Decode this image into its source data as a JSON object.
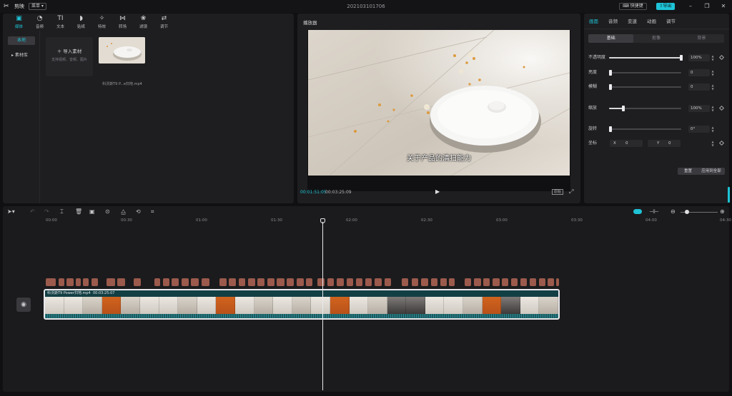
{
  "titlebar": {
    "app_name": "剪映",
    "menu_label": "菜单",
    "doc_title": "202103101706",
    "shortcut_label": "快捷键",
    "export_label": "导出"
  },
  "media": {
    "tabs": [
      {
        "label": "媒体",
        "icon": "media-icon",
        "glyph": "▣",
        "active": true
      },
      {
        "label": "音频",
        "icon": "audio-icon",
        "glyph": "◔",
        "active": false
      },
      {
        "label": "文本",
        "icon": "text-icon",
        "glyph": "TI",
        "active": false
      },
      {
        "label": "贴纸",
        "icon": "sticker-icon",
        "glyph": "◗",
        "active": false
      },
      {
        "label": "特效",
        "icon": "effect-icon",
        "glyph": "✧",
        "active": false
      },
      {
        "label": "转场",
        "icon": "transition-icon",
        "glyph": "⋈",
        "active": false
      },
      {
        "label": "滤镜",
        "icon": "filter-icon",
        "glyph": "❀",
        "active": false
      },
      {
        "label": "调节",
        "icon": "adjust-icon",
        "glyph": "⇄",
        "active": false
      }
    ],
    "side_local": "本地",
    "side_library": "素材库",
    "import_label": "导入素材",
    "import_hint": "支持视频、音频、图片",
    "thumb_name": "科沃斯T9 P...e扫地.mp4"
  },
  "player": {
    "title": "播放器",
    "subtitle": "关于产品的清扫能力",
    "time_current": "00:01:51:05",
    "time_total": "00:03:25:09",
    "ratio_label": "原始"
  },
  "props": {
    "tabs": [
      {
        "label": "画面",
        "active": true
      },
      {
        "label": "音频",
        "active": false
      },
      {
        "label": "变速",
        "active": false
      },
      {
        "label": "动画",
        "active": false
      },
      {
        "label": "调节",
        "active": false
      }
    ],
    "sub_tabs": [
      {
        "label": "基础",
        "active": true
      },
      {
        "label": "抠像",
        "active": false
      },
      {
        "label": "背景",
        "active": false
      }
    ],
    "opacity": {
      "label": "不透明度",
      "value": "100%",
      "level": 1.0
    },
    "brightness": {
      "label": "亮度",
      "value": "0",
      "level": 0.0
    },
    "blur": {
      "label": "模糊",
      "value": "0",
      "level": 0.0
    },
    "scale": {
      "label": "缩放",
      "value": "100%",
      "level": 0.2
    },
    "rotate": {
      "label": "旋转",
      "value": "0°",
      "level": 0.0
    },
    "position": {
      "label": "坐标",
      "x_label": "X",
      "x_value": "0",
      "y_label": "Y",
      "y_value": "0"
    },
    "reset_label": "重置",
    "apply_all_label": "应用到全部"
  },
  "timeline": {
    "ruler": [
      "00:00",
      "00:30",
      "01:00",
      "01:30",
      "02:00",
      "02:30",
      "03:00",
      "03:30",
      "04:00",
      "04:30"
    ],
    "clip_name": "科沃斯T9 Power扫地.mp4",
    "clip_duration": "00:03:25:07"
  },
  "colors": {
    "accent": "#1ec3d6",
    "text_clip": "#9b5a4c",
    "video_clip": "#1d5a5f"
  }
}
